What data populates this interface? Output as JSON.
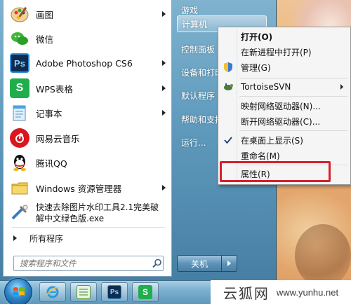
{
  "programs": [
    {
      "label": "画图",
      "icon": "paint-icon",
      "has_submenu": true
    },
    {
      "label": "微信",
      "icon": "wechat-icon",
      "has_submenu": false
    },
    {
      "label": "Adobe Photoshop CS6",
      "icon": "photoshop-icon",
      "has_submenu": true
    },
    {
      "label": "WPS表格",
      "icon": "wps-icon",
      "has_submenu": true
    },
    {
      "label": "记事本",
      "icon": "notepad-icon",
      "has_submenu": true
    },
    {
      "label": "网易云音乐",
      "icon": "netease-music-icon",
      "has_submenu": false
    },
    {
      "label": "腾讯QQ",
      "icon": "qq-icon",
      "has_submenu": false
    },
    {
      "label": "Windows 资源管理器",
      "icon": "explorer-icon",
      "has_submenu": true
    },
    {
      "label": "快速去除图片水印工具2.1完美破解中文绿色版.exe",
      "icon": "watermark-tool-icon",
      "has_submenu": false
    }
  ],
  "all_programs_label": "所有程序",
  "search": {
    "placeholder": "搜索程序和文件"
  },
  "right_pane": {
    "items": [
      "游戏",
      "计算机",
      "控制面板",
      "设备和打印机",
      "默认程序",
      "帮助和支持",
      "运行..."
    ]
  },
  "shutdown_label": "关机",
  "context_menu": {
    "items": [
      {
        "label": "打开(O)",
        "bold": true
      },
      {
        "label": "在新进程中打开(P)"
      },
      {
        "label": "管理(G)",
        "icon": "shield-icon"
      },
      {
        "label": "TortoiseSVN",
        "icon": "tortoise-icon",
        "submenu": true
      },
      {
        "label": "映射网络驱动器(N)..."
      },
      {
        "label": "断开网络驱动器(C)..."
      },
      {
        "label": "在桌面上显示(S)",
        "checked": true
      },
      {
        "label": "重命名(M)"
      },
      {
        "label": "属性(R)"
      }
    ]
  },
  "taskbar": {
    "buttons": [
      "ie-icon",
      "spreadsheet-icon",
      "photoshop-icon",
      "wps-icon"
    ]
  },
  "watermark": {
    "cn": "云狐网",
    "url": "www.yunhu.net"
  },
  "colors": {
    "highlight": "#d3212c",
    "accent": "#4a7fa3"
  }
}
